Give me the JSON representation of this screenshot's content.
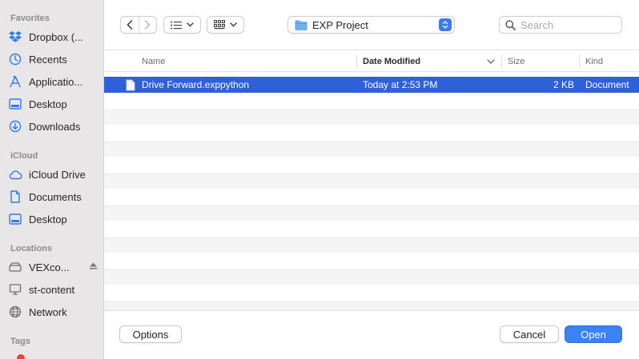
{
  "sidebar": {
    "sections": [
      {
        "title": "Favorites",
        "items": [
          {
            "label": "Dropbox (...",
            "icon": "dropbox-icon"
          },
          {
            "label": "Recents",
            "icon": "clock-icon"
          },
          {
            "label": "Applicatio...",
            "icon": "applications-icon"
          },
          {
            "label": "Desktop",
            "icon": "desktop-icon"
          },
          {
            "label": "Downloads",
            "icon": "download-icon"
          }
        ]
      },
      {
        "title": "iCloud",
        "items": [
          {
            "label": "iCloud Drive",
            "icon": "cloud-icon"
          },
          {
            "label": "Documents",
            "icon": "document-icon"
          },
          {
            "label": "Desktop",
            "icon": "desktop-icon"
          }
        ]
      },
      {
        "title": "Locations",
        "items": [
          {
            "label": "VEXco...",
            "icon": "drive-icon",
            "eject": true
          },
          {
            "label": "st-content",
            "icon": "display-icon"
          },
          {
            "label": "Network",
            "icon": "globe-icon"
          }
        ]
      },
      {
        "title": "Tags",
        "items": []
      }
    ]
  },
  "toolbar": {
    "location": "EXP Project",
    "search_placeholder": "Search"
  },
  "table": {
    "columns": [
      "Name",
      "Date Modified",
      "Size",
      "Kind"
    ],
    "sorted_column": "Date Modified",
    "rows": [
      {
        "name": "Drive Forward.exppython",
        "date": "Today at 2:53 PM",
        "size": "2 KB",
        "kind": "Document",
        "selected": true
      }
    ]
  },
  "footer": {
    "options_label": "Options",
    "cancel_label": "Cancel",
    "open_label": "Open"
  },
  "colors": {
    "accent": "#3b82f6",
    "selection": "#2f5fd9",
    "sidebar_icon": "#2f7bf5"
  }
}
